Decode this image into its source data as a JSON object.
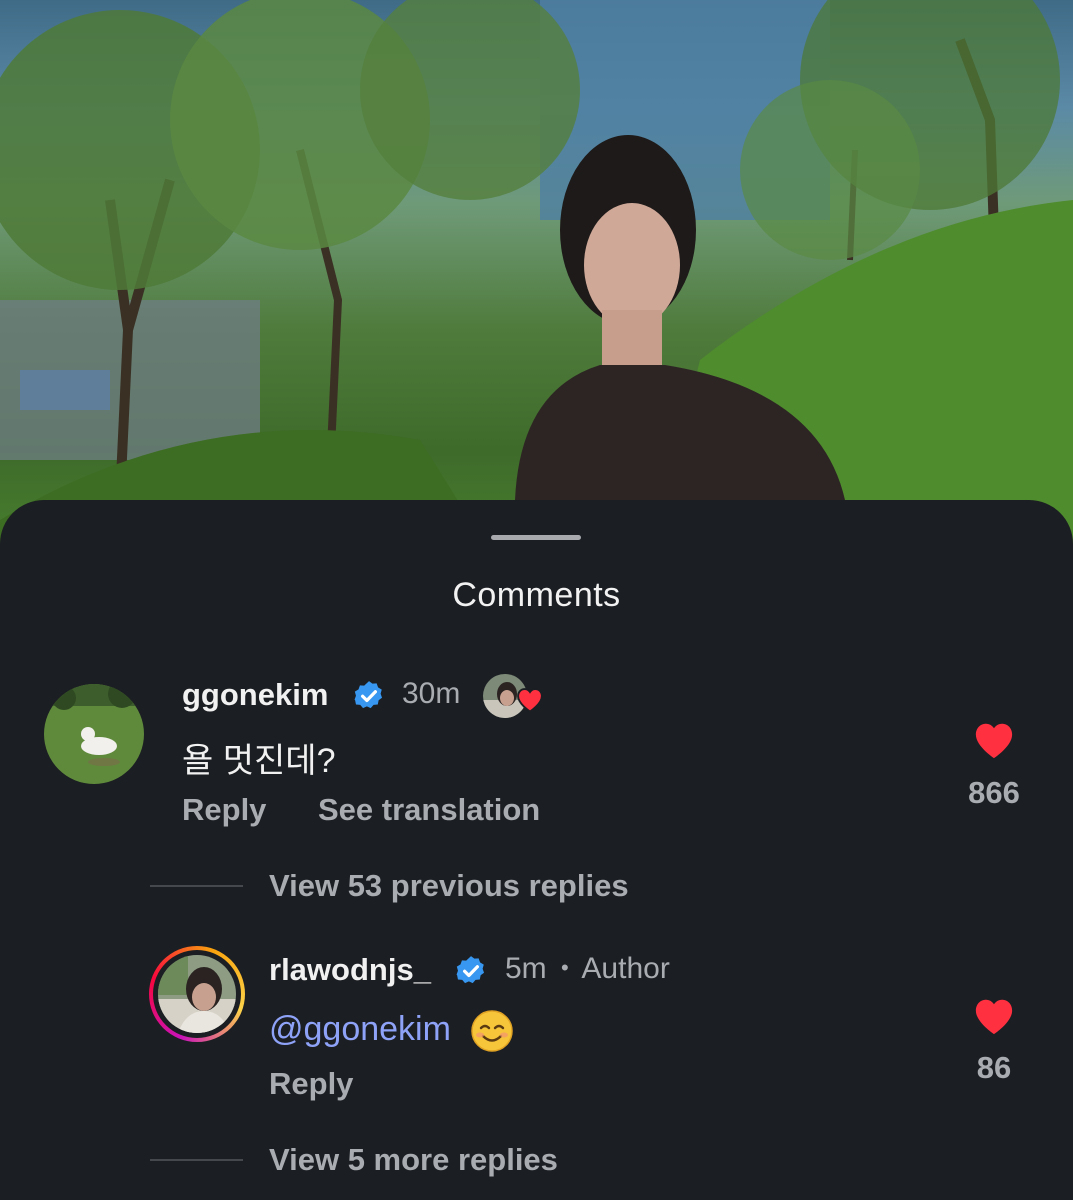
{
  "sheet": {
    "title": "Comments"
  },
  "comments": [
    {
      "username": "ggonekim",
      "verified": true,
      "time": "30m",
      "author_liked": true,
      "text": "욜 멋진데?",
      "reply_label": "Reply",
      "translate_label": "See translation",
      "like_count": "866",
      "avatar_icon": "dog-on-grass-photo"
    }
  ],
  "thread": {
    "view_previous": "View 53 previous replies",
    "view_more": "View 5 more replies"
  },
  "replies": [
    {
      "username": "rlawodnjs_",
      "verified": true,
      "time": "5m",
      "separator": "•",
      "badge": "Author",
      "mention": "@ggonekim",
      "emoji": "smiling-face-icon",
      "reply_label": "Reply",
      "like_count": "86",
      "avatar_icon": "profile-photo-with-story-ring"
    }
  ],
  "colors": {
    "sheet_background": "#1b1e22",
    "heart": "#ff3040",
    "verified_blue": "#3897f0",
    "mention": "#8ea2f7"
  }
}
